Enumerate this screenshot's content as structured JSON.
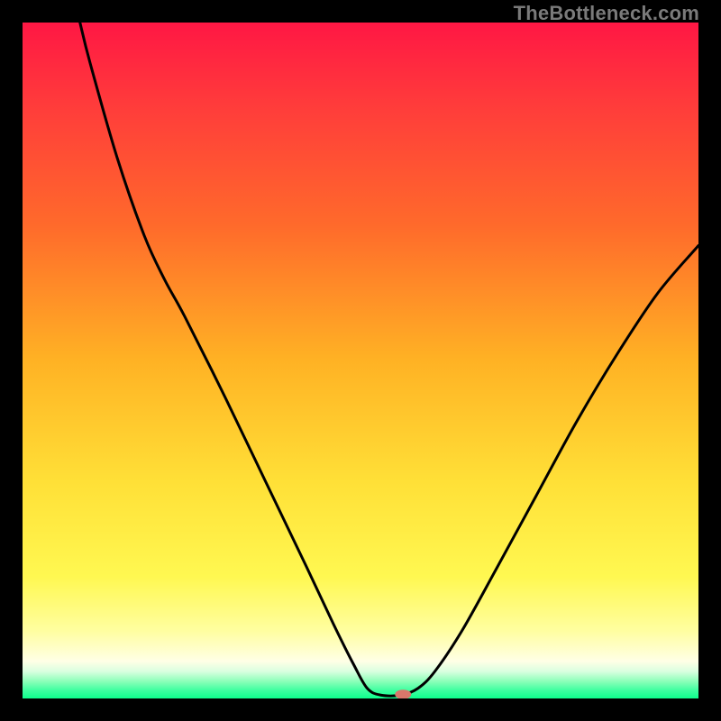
{
  "watermark": "TheBottleneck.com",
  "chart_data": {
    "type": "line",
    "title": "",
    "xlabel": "",
    "ylabel": "",
    "xlim": [
      0,
      100
    ],
    "ylim": [
      0,
      100
    ],
    "background_gradient": {
      "stops": [
        {
          "offset": 0.0,
          "color": "#ff1744"
        },
        {
          "offset": 0.12,
          "color": "#ff3b3b"
        },
        {
          "offset": 0.3,
          "color": "#ff6a2b"
        },
        {
          "offset": 0.5,
          "color": "#ffb224"
        },
        {
          "offset": 0.68,
          "color": "#ffe037"
        },
        {
          "offset": 0.82,
          "color": "#fff851"
        },
        {
          "offset": 0.9,
          "color": "#fffea0"
        },
        {
          "offset": 0.945,
          "color": "#ffffe6"
        },
        {
          "offset": 0.96,
          "color": "#d9ffe0"
        },
        {
          "offset": 0.975,
          "color": "#8affb8"
        },
        {
          "offset": 0.988,
          "color": "#3effa0"
        },
        {
          "offset": 1.0,
          "color": "#0eff8d"
        }
      ]
    },
    "series": [
      {
        "name": "bottleneck-curve",
        "color": "#000000",
        "points": [
          {
            "x": 8.5,
            "y": 100.0
          },
          {
            "x": 10.0,
            "y": 94.0
          },
          {
            "x": 14.0,
            "y": 80.0
          },
          {
            "x": 18.0,
            "y": 68.5
          },
          {
            "x": 21.0,
            "y": 62.0
          },
          {
            "x": 24.0,
            "y": 56.5
          },
          {
            "x": 30.0,
            "y": 44.5
          },
          {
            "x": 36.0,
            "y": 32.0
          },
          {
            "x": 42.0,
            "y": 19.5
          },
          {
            "x": 46.0,
            "y": 11.0
          },
          {
            "x": 49.0,
            "y": 5.0
          },
          {
            "x": 51.0,
            "y": 1.5
          },
          {
            "x": 53.0,
            "y": 0.5
          },
          {
            "x": 56.0,
            "y": 0.5
          },
          {
            "x": 58.5,
            "y": 1.5
          },
          {
            "x": 61.0,
            "y": 4.0
          },
          {
            "x": 65.0,
            "y": 10.0
          },
          {
            "x": 70.0,
            "y": 19.0
          },
          {
            "x": 76.0,
            "y": 30.0
          },
          {
            "x": 82.0,
            "y": 41.0
          },
          {
            "x": 88.0,
            "y": 51.0
          },
          {
            "x": 94.0,
            "y": 60.0
          },
          {
            "x": 100.0,
            "y": 67.0
          }
        ]
      }
    ],
    "marker": {
      "x": 56.3,
      "y": 0.6,
      "color": "#d9776b",
      "rx": 1.2,
      "ry": 0.7
    }
  }
}
